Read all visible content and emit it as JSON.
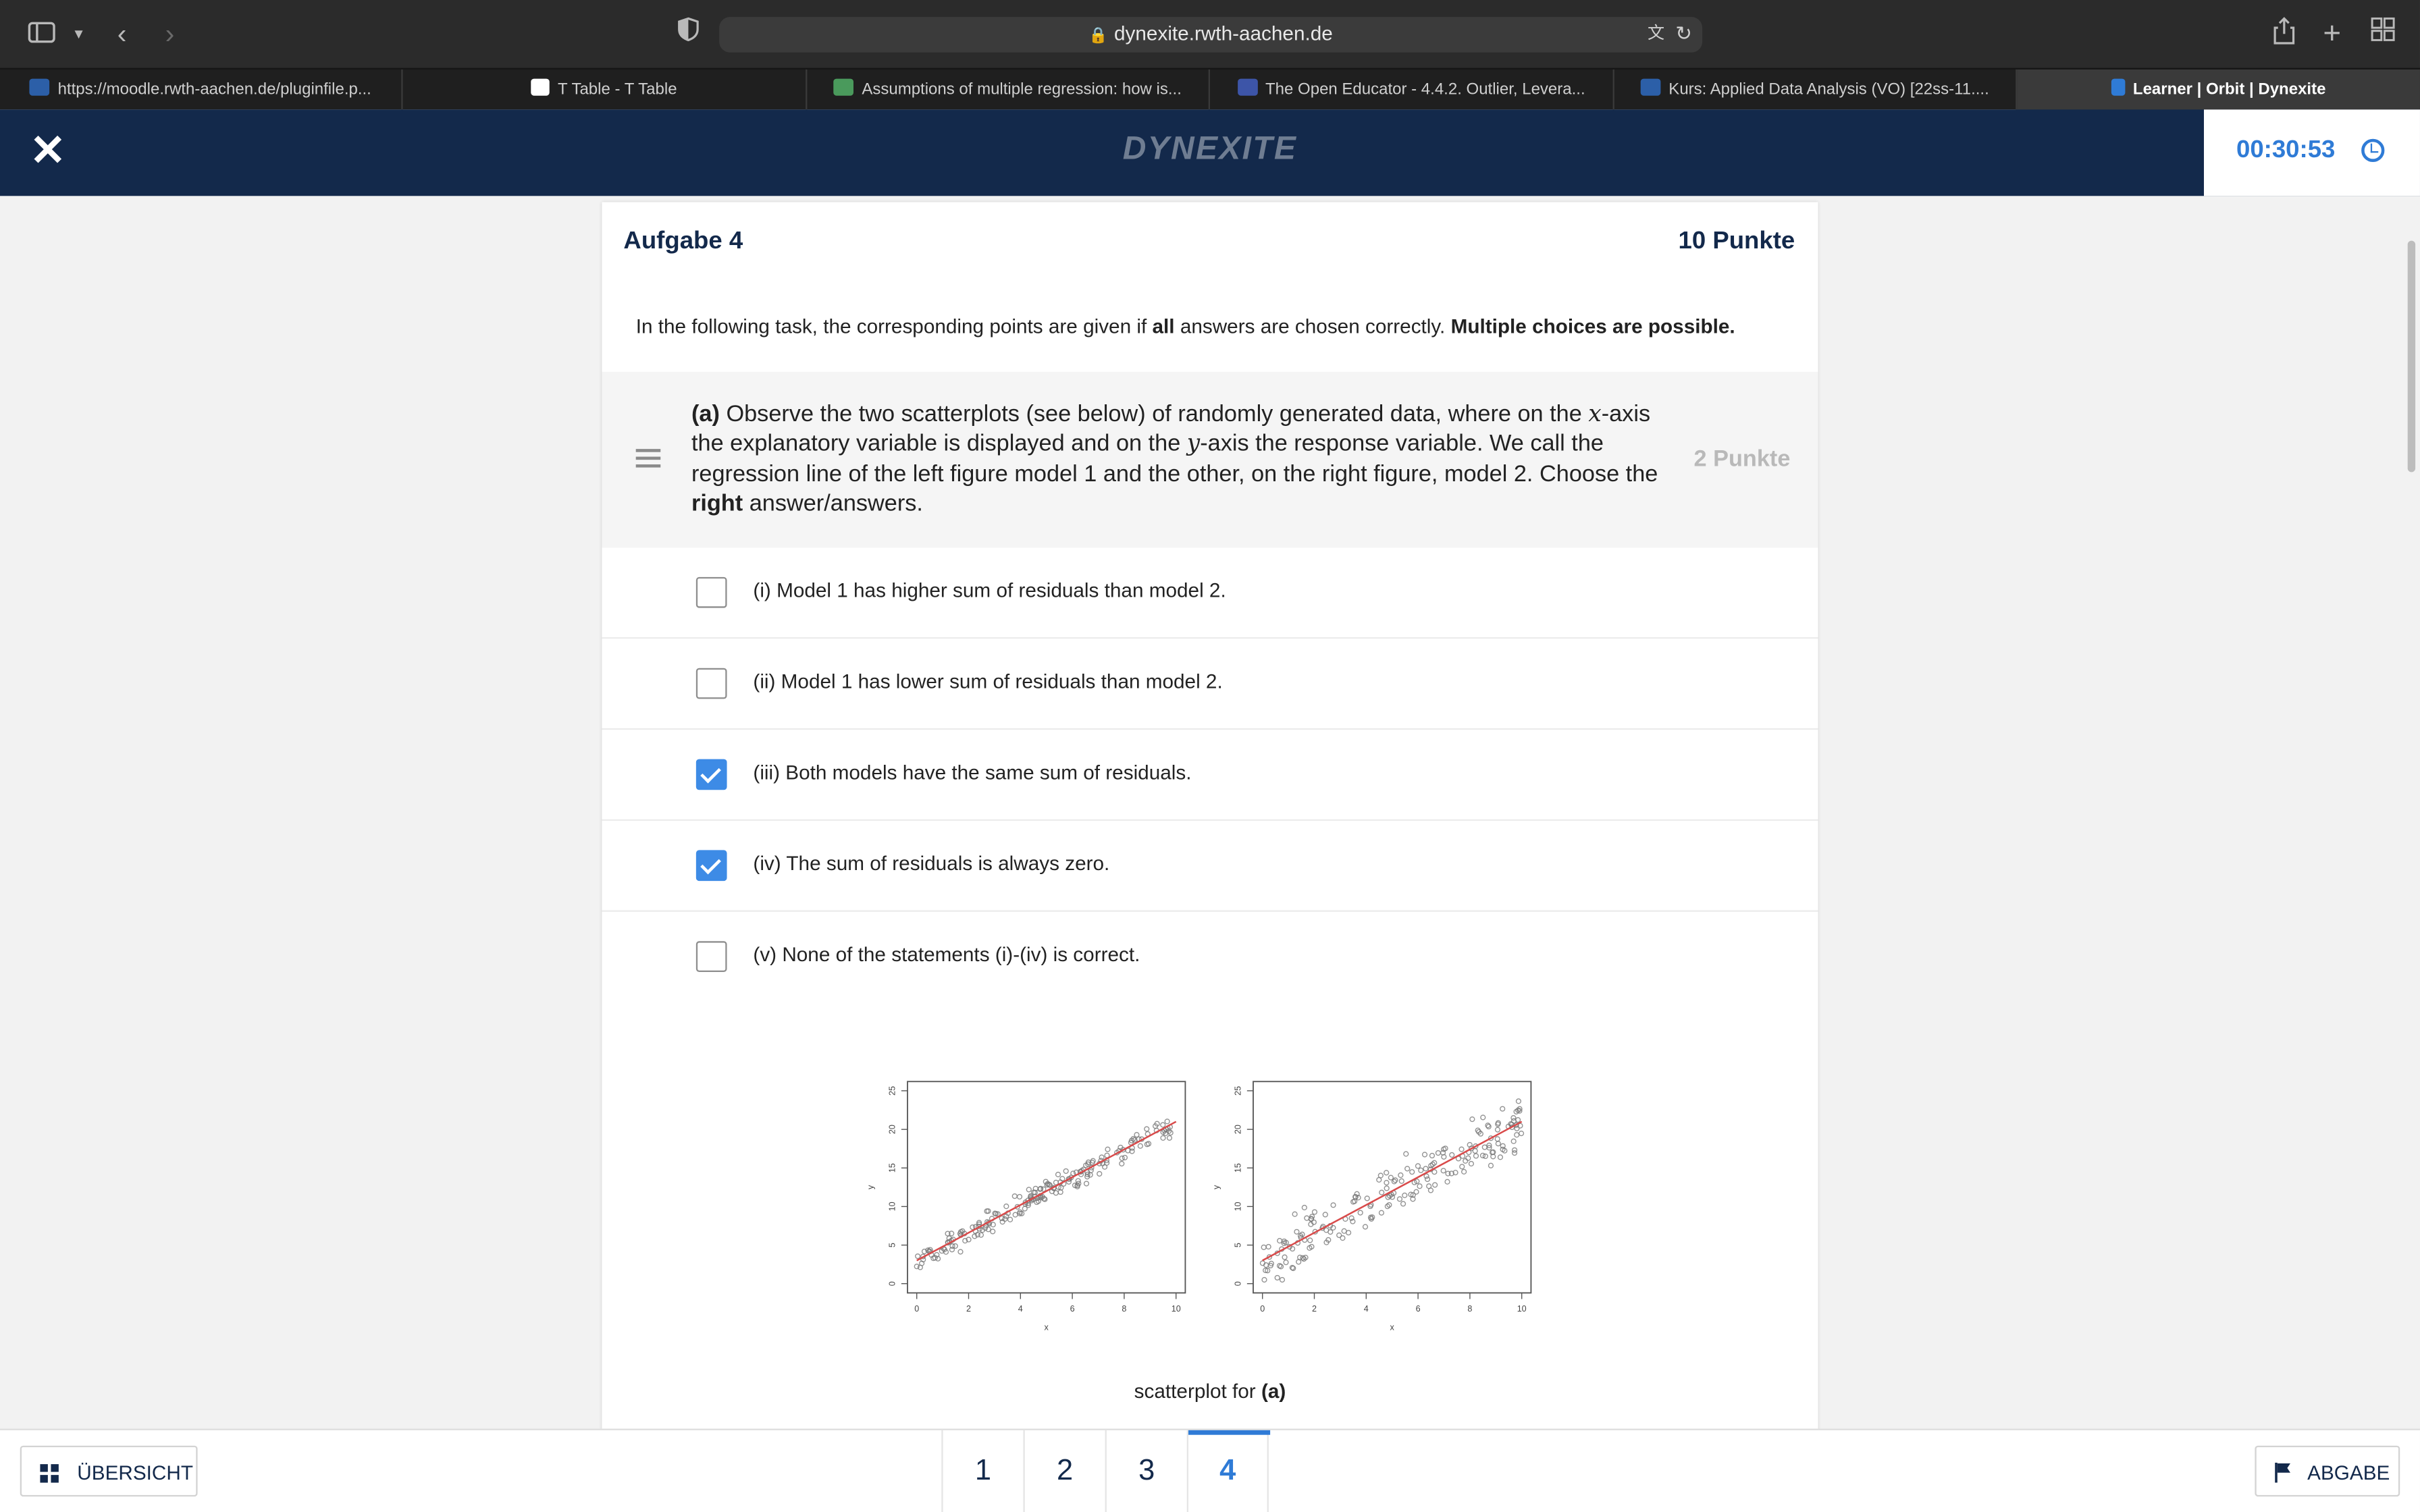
{
  "browser": {
    "address": "dynexite.rwth-aachen.de",
    "tabs": [
      {
        "label": "https://moodle.rwth-aachen.de/pluginfile.p...",
        "active": false
      },
      {
        "label": "T Table - T Table",
        "active": false
      },
      {
        "label": "Assumptions of multiple regression: how is...",
        "active": false
      },
      {
        "label": "The Open Educator - 4.4.2. Outlier, Levera...",
        "active": false
      },
      {
        "label": "Kurs: Applied Data Analysis (VO) [22ss-11....",
        "active": false
      },
      {
        "label": "Learner | Orbit | Dynexite",
        "active": true
      }
    ]
  },
  "header": {
    "logo": "DYNEXITE",
    "timer": "00:30:53"
  },
  "task": {
    "title": "Aufgabe 4",
    "points": "10 Punkte",
    "intro_pre": "In the following task, the corresponding points are given if ",
    "intro_bold1": "all",
    "intro_mid": " answers are chosen correctly. ",
    "intro_bold2": "Multiple choices are possible."
  },
  "question": {
    "label": "(a)",
    "text_1": " Observe the two scatterplots (see below) of randomly generated data, where on the ",
    "var_x": "x",
    "text_2": "-axis the explanatory variable is displayed and on the ",
    "var_y": "y",
    "text_3": "-axis the response variable. We call the regression line of the left figure model 1 and the other, on the right figure, model 2. Choose the ",
    "text_bold": "right",
    "text_4": " answer/answers.",
    "points": "2 Punkte"
  },
  "options": [
    {
      "label": "(i) Model 1 has higher sum of residuals than model 2.",
      "checked": false
    },
    {
      "label": "(ii) Model 1 has lower sum of residuals than model 2.",
      "checked": false
    },
    {
      "label": "(iii) Both models have the same sum of residuals.",
      "checked": true
    },
    {
      "label": "(iv) The sum of residuals is always zero.",
      "checked": true
    },
    {
      "label": "(v) None of the statements (i)-(iv) is correct.",
      "checked": false
    }
  ],
  "figure": {
    "caption_pre": "scatterplot for ",
    "caption_bold": "(a)",
    "plots": [
      {
        "xlabel": "x",
        "ylabel": "y",
        "xticks": [
          "0",
          "2",
          "4",
          "6",
          "8",
          "10"
        ],
        "yticks": [
          "0",
          "5",
          "10",
          "15",
          "20",
          "25"
        ],
        "line_color": "#d94a4a"
      },
      {
        "xlabel": "x",
        "ylabel": "y",
        "xticks": [
          "0",
          "2",
          "4",
          "6",
          "8",
          "10"
        ],
        "yticks": [
          "0",
          "5",
          "10",
          "15",
          "20",
          "25"
        ],
        "line_color": "#d94a4a"
      }
    ]
  },
  "nav": {
    "overview": "ÜBERSICHT",
    "pages": [
      "1",
      "2",
      "3",
      "4"
    ],
    "current_page": "4",
    "submit": "ABGABE"
  },
  "colors": {
    "navy": "#13294b",
    "accent": "#2f7bd6",
    "checkbox": "#3d8be6"
  }
}
